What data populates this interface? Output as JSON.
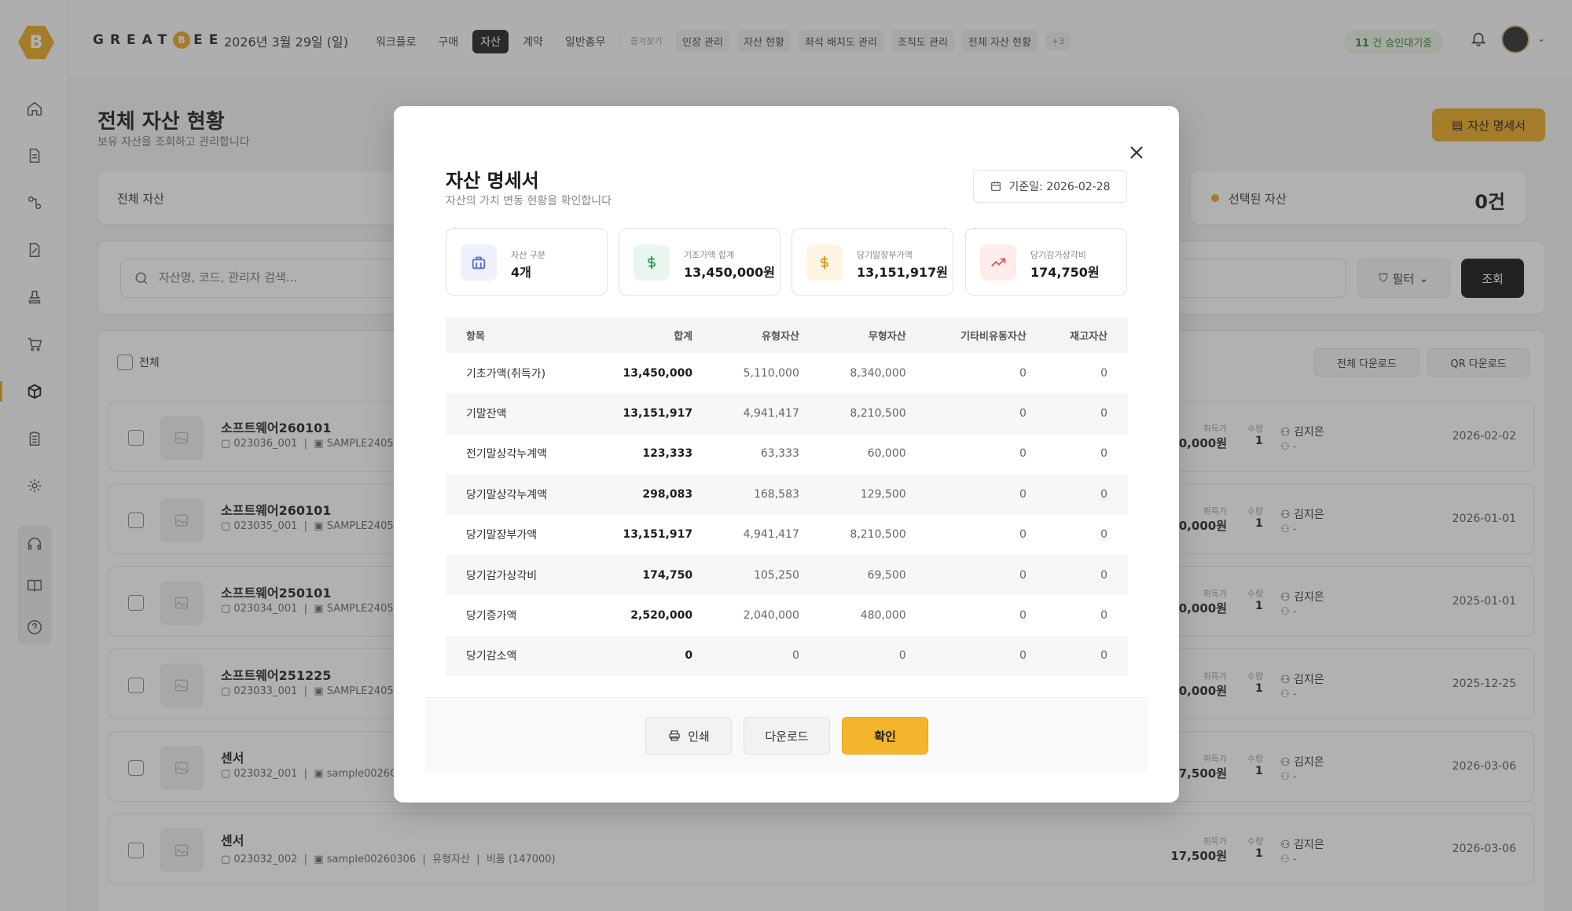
{
  "sidebar": {
    "logo": "B",
    "items": [
      "home",
      "document",
      "workflow",
      "contract",
      "stamp",
      "cart",
      "box",
      "building",
      "gear",
      "headset",
      "book",
      "help"
    ]
  },
  "header": {
    "brand_left": "GREAT",
    "brand_bee": "B",
    "brand_right": "EE",
    "date": "2026년 3월 29일 (일)",
    "menu": [
      "워크플로",
      "구매",
      "자산",
      "계약",
      "일반총무"
    ],
    "active_menu": "자산",
    "favorites_label": "즐겨찾기",
    "favorites": [
      "인장 관리",
      "자산 현황",
      "좌석 배치도 관리",
      "조직도 관리",
      "전체 자산 현황"
    ],
    "favorites_more": "+3",
    "approval_count": "11",
    "approval_text": "건 승인대기중"
  },
  "page": {
    "title": "전체 자산 현황",
    "subtitle": "보유 자산을 조회하고 관리합니다",
    "statement_button": "자산 명세서",
    "all_assets_label": "전체 자산",
    "selected_label": "선택된 자산",
    "selected_count": "0건",
    "search_placeholder": "자산명, 코드, 관리자 검색...",
    "filter_label": "필터",
    "query_label": "조회",
    "select_all_label": "전체",
    "download_all_label": "전체 다운로드",
    "qr_download_label": "QR 다운로드"
  },
  "rows": [
    {
      "name": "소프트웨어260101",
      "code": "023036_001",
      "sample": "SAMPLE2405",
      "price": "40,000원",
      "qty": "1",
      "owner": "김지은",
      "sub": "-",
      "date": "2026-02-02"
    },
    {
      "name": "소프트웨어260101",
      "code": "023035_001",
      "sample": "SAMPLE2405",
      "price": "30,000원",
      "qty": "1",
      "owner": "김지은",
      "sub": "-",
      "date": "2026-01-01"
    },
    {
      "name": "소프트웨어250101",
      "code": "023034_001",
      "sample": "SAMPLE2405",
      "price": "00,000원",
      "qty": "1",
      "owner": "김지은",
      "sub": "-",
      "date": "2025-01-01"
    },
    {
      "name": "소프트웨어251225",
      "code": "023033_001",
      "sample": "SAMPLE2405",
      "price": "00,000원",
      "qty": "1",
      "owner": "김지은",
      "sub": "-",
      "date": "2025-12-25"
    },
    {
      "name": "센서",
      "code": "023032_001",
      "sample": "sample0026C",
      "price": "17,500원",
      "qty": "1",
      "owner": "김지은",
      "sub": "-",
      "date": "2026-03-06"
    },
    {
      "name": "센서",
      "code": "023032_002",
      "sample": "sample00260306",
      "extra": "유형자산",
      "extra2": "비품 (147000)",
      "price": "17,500원",
      "qty": "1",
      "owner": "김지은",
      "sub": "-",
      "date": "2026-03-06"
    }
  ],
  "row_labels": {
    "price": "취득가",
    "qty": "수량"
  },
  "modal": {
    "title": "자산 명세서",
    "subtitle": "자산의 가치 변동 현황을 확인합니다",
    "base_date": "기준일: 2026-02-28",
    "stats": [
      {
        "label": "자산 구분",
        "value": "4개",
        "icon": "briefcase-icon",
        "color": "#5b6fd6",
        "bg": "#eef0fb"
      },
      {
        "label": "기초가액 합계",
        "value": "13,450,000원",
        "icon": "dollar-icon",
        "color": "#2e9a5b",
        "bg": "#e8f6ee"
      },
      {
        "label": "당기말장부가액",
        "value": "13,151,917원",
        "icon": "dollar-icon",
        "color": "#d99a1c",
        "bg": "#fdf4e2"
      },
      {
        "label": "당기감가상각비",
        "value": "174,750원",
        "icon": "trend-icon",
        "color": "#d65b5b",
        "bg": "#fdecec"
      }
    ],
    "table": {
      "headers": [
        "항목",
        "합계",
        "유형자산",
        "무형자산",
        "기타비유동자산",
        "재고자산"
      ],
      "rows": [
        [
          "기초가액(취득가)",
          "13,450,000",
          "5,110,000",
          "8,340,000",
          "0",
          "0"
        ],
        [
          "기말잔액",
          "13,151,917",
          "4,941,417",
          "8,210,500",
          "0",
          "0"
        ],
        [
          "전기말상각누계액",
          "123,333",
          "63,333",
          "60,000",
          "0",
          "0"
        ],
        [
          "당기말상각누계액",
          "298,083",
          "168,583",
          "129,500",
          "0",
          "0"
        ],
        [
          "당기말장부가액",
          "13,151,917",
          "4,941,417",
          "8,210,500",
          "0",
          "0"
        ],
        [
          "당기감가상각비",
          "174,750",
          "105,250",
          "69,500",
          "0",
          "0"
        ],
        [
          "당기증가액",
          "2,520,000",
          "2,040,000",
          "480,000",
          "0",
          "0"
        ],
        [
          "당기감소액",
          "0",
          "0",
          "0",
          "0",
          "0"
        ]
      ]
    },
    "buttons": {
      "print": "인쇄",
      "download": "다운로드",
      "confirm": "확인"
    }
  }
}
